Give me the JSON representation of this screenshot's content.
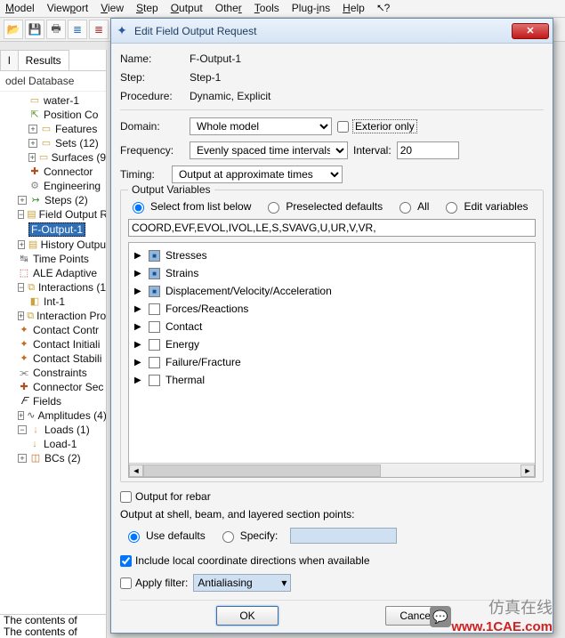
{
  "menubar": [
    "Model",
    "Viewport",
    "View",
    "Step",
    "Output",
    "Other",
    "Tools",
    "Plug-ins",
    "Help"
  ],
  "toolbar_icons": [
    "folder-open",
    "save",
    "print",
    "db-blue",
    "db-red",
    "db-yellow"
  ],
  "left_tabs": {
    "tab1": "l",
    "tab2": "Results"
  },
  "tree_title": "odel Database",
  "tree": {
    "water": "water-1",
    "position": "Position Co",
    "features": "Features",
    "sets": "Sets (12)",
    "surfaces": "Surfaces (9",
    "connector": "Connector",
    "engineering": "Engineering",
    "steps": "Steps (2)",
    "field_out": "Field Output R",
    "f_output_1": "F-Output-1",
    "history": "History Outpu",
    "time_points": "Time Points",
    "ale": "ALE Adaptive",
    "interactions": "Interactions (1",
    "int1": "Int-1",
    "interaction_pro": "Interaction Pro",
    "contact_contr": "Contact Contr",
    "contact_init": "Contact Initiali",
    "contact_stab": "Contact Stabili",
    "constraints": "Constraints",
    "connector_sec": "Connector Sec",
    "fields": "Fields",
    "amplitudes": "Amplitudes (4)",
    "loads": "Loads (1)",
    "load1": "Load-1",
    "bcs": "BCs (2)"
  },
  "log": {
    "l1": "The contents of",
    "l2": "The contents of"
  },
  "dialog": {
    "title": "Edit Field Output Request",
    "name_lab": "Name:",
    "name_val": "F-Output-1",
    "step_lab": "Step:",
    "step_val": "Step-1",
    "proc_lab": "Procedure:",
    "proc_val": "Dynamic, Explicit",
    "domain_lab": "Domain:",
    "domain_val": "Whole model",
    "exterior": "Exterior only",
    "freq_lab": "Frequency:",
    "freq_val": "Evenly spaced time intervals",
    "interval_lab": "Interval:",
    "interval_val": "20",
    "timing_lab": "Timing:",
    "timing_val": "Output at approximate times",
    "outvar_legend": "Output Variables",
    "radios": {
      "r1": "Select from list below",
      "r2": "Preselected defaults",
      "r3": "All",
      "r4": "Edit variables"
    },
    "varfield": "COORD,EVF,EVOL,IVOL,LE,S,SVAVG,U,UR,V,VR,",
    "vars": [
      {
        "label": "Stresses",
        "on": true
      },
      {
        "label": "Strains",
        "on": true
      },
      {
        "label": "Displacement/Velocity/Acceleration",
        "on": true
      },
      {
        "label": "Forces/Reactions",
        "on": false
      },
      {
        "label": "Contact",
        "on": false
      },
      {
        "label": "Energy",
        "on": false
      },
      {
        "label": "Failure/Fracture",
        "on": false
      },
      {
        "label": "Thermal",
        "on": false
      }
    ],
    "rebar": "Output for rebar",
    "shell_line": "Output at shell, beam, and layered section points:",
    "use_defaults": "Use defaults",
    "specify": "Specify:",
    "include_local": "Include local coordinate directions when available",
    "apply_filter": "Apply filter:",
    "filter_val": "Antialiasing",
    "ok": "OK",
    "cancel": "Cancel"
  },
  "watermark": {
    "cn": "仿真在线",
    "url": "www.1CAE.com"
  }
}
